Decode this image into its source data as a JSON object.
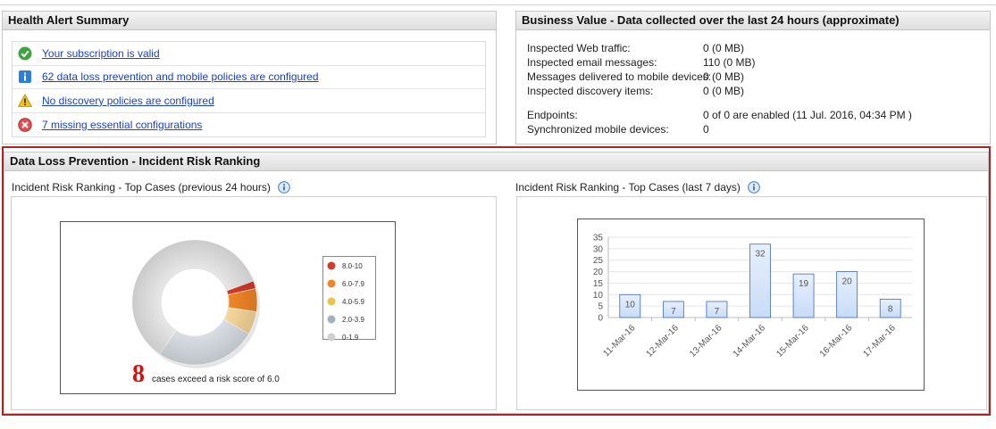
{
  "health": {
    "title": "Health Alert Summary",
    "alerts": [
      {
        "icon": "check-icon",
        "text": "Your subscription is valid"
      },
      {
        "icon": "info-icon",
        "text": "62 data loss prevention and mobile policies are configured"
      },
      {
        "icon": "warning-icon",
        "text": "No discovery policies are configured"
      },
      {
        "icon": "error-icon",
        "text": "7 missing essential configurations"
      }
    ]
  },
  "business": {
    "title": "Business Value - Data collected over the last 24 hours (approximate)",
    "rows": [
      {
        "label": "Inspected Web traffic:",
        "value": "0 (0 MB)"
      },
      {
        "label": "Inspected email messages:",
        "value": "110 (0 MB)"
      },
      {
        "label": "Messages delivered to mobile devices:",
        "value": "0 (0 MB)"
      },
      {
        "label": "Inspected discovery items:",
        "value": "0 (0 MB)"
      }
    ],
    "rows2": [
      {
        "label": "Endpoints:",
        "value": "0 of 0 are enabled (11 Jul. 2016, 04:34 PM )"
      },
      {
        "label": "Synchronized mobile devices:",
        "value": "0"
      }
    ]
  },
  "dlp": {
    "title": "Data Loss Prevention - Incident Risk Ranking",
    "left_title": "Incident Risk Ranking - Top Cases (previous 24 hours)",
    "right_title": "Incident Risk Ranking - Top Cases (last 7 days)",
    "cases_count": "8",
    "cases_text": "cases exceed a risk score of 6.0"
  },
  "chart_data": [
    {
      "type": "pie",
      "categories": [
        "8.0-10",
        "6.0-7.9",
        "4.0-5.9",
        "2.0-3.9",
        "0-1.9"
      ],
      "values": [
        2,
        6,
        6,
        26,
        60
      ],
      "colors": [
        "#d23a2a",
        "#f08526",
        "#f7d79a",
        "#d7dde2",
        "#e6e6e6"
      ]
    },
    {
      "type": "bar",
      "categories": [
        "11-Mar-16",
        "12-Mar-16",
        "13-Mar-16",
        "14-Mar-16",
        "15-Mar-16",
        "16-Mar-16",
        "17-Mar-16"
      ],
      "values": [
        10,
        7,
        7,
        32,
        19,
        20,
        8
      ],
      "ylim": [
        0,
        35
      ],
      "yticks": [
        0,
        5,
        10,
        15,
        20,
        25,
        30,
        35
      ],
      "colors": {
        "bar": "#c8dcf7",
        "bar_border": "#3e68c8"
      }
    }
  ]
}
